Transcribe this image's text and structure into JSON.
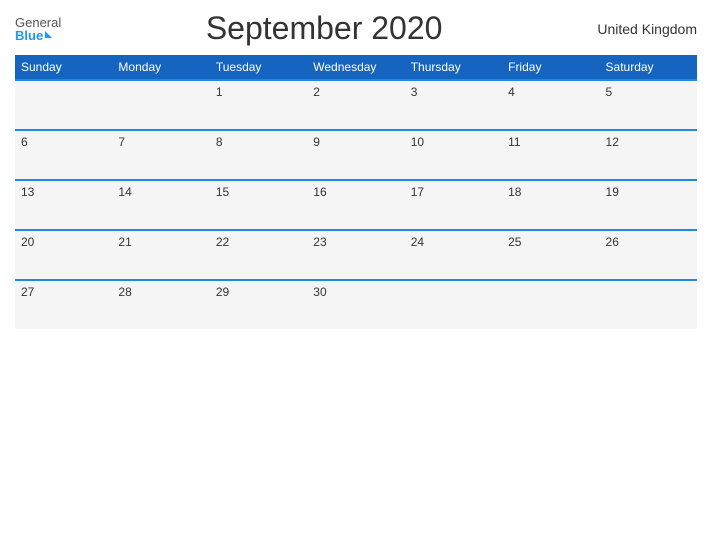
{
  "header": {
    "logo_general": "General",
    "logo_blue": "Blue",
    "title": "September 2020",
    "region": "United Kingdom"
  },
  "weekdays": [
    "Sunday",
    "Monday",
    "Tuesday",
    "Wednesday",
    "Thursday",
    "Friday",
    "Saturday"
  ],
  "weeks": [
    [
      "",
      "",
      "1",
      "2",
      "3",
      "4",
      "5"
    ],
    [
      "6",
      "7",
      "8",
      "9",
      "10",
      "11",
      "12"
    ],
    [
      "13",
      "14",
      "15",
      "16",
      "17",
      "18",
      "19"
    ],
    [
      "20",
      "21",
      "22",
      "23",
      "24",
      "25",
      "26"
    ],
    [
      "27",
      "28",
      "29",
      "30",
      "",
      "",
      ""
    ]
  ]
}
